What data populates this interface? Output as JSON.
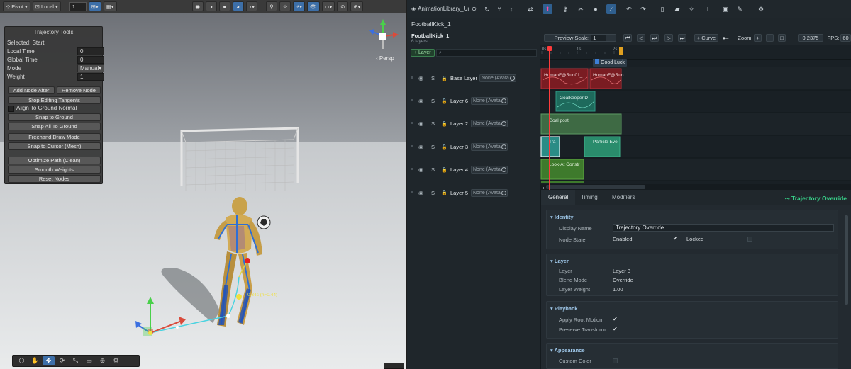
{
  "scene": {
    "toolbar": {
      "pivot": "Pivot",
      "local": "Local",
      "grid_value": "1"
    },
    "persp_label": "‹ Persp",
    "trajectory_tools": {
      "title": "Trajectory Tools",
      "selected": "Selected: Start",
      "local_time_label": "Local Time",
      "local_time_value": "0",
      "global_time_label": "Global Time",
      "global_time_value": "0",
      "mode_label": "Mode",
      "mode_value": "Manual",
      "weight_label": "Weight",
      "weight_value": "1",
      "add_node_after": "Add Node After",
      "remove_node": "Remove Node",
      "stop_editing_tangents": "Stop Editing Tangents",
      "align_to_ground_normal": "Align To Ground Normal",
      "snap_to_ground": "Snap to Ground",
      "snap_all_to_ground": "Snap All To Ground",
      "freehand_draw_mode": "Freehand Draw Mode",
      "snap_to_cursor": "Snap to Cursor (Mesh)",
      "optimize_path": "Optimize Path (Clean)",
      "smooth_weights": "Smooth Weights",
      "reset_nodes": "Reset Nodes"
    },
    "trajectory_annotation": "0.34s  (h=0.44)"
  },
  "anim": {
    "tab_title": "AnimationLibrary_Ur",
    "breadcrumb": "FootballKick_1",
    "clip_name": "FootballKick_1",
    "clip_layers": "6 layers",
    "add_layer": "+ Layer",
    "search_icon_glyph": "⌕",
    "tracks": [
      {
        "name": "Base Layer",
        "avatar": "None (Avata"
      },
      {
        "name": "Layer 6",
        "avatar": "None (Avata"
      },
      {
        "name": "Layer 2",
        "avatar": "None (Avata"
      },
      {
        "name": "Layer 3",
        "avatar": "None (Avata"
      },
      {
        "name": "Layer 4",
        "avatar": "None (Avata"
      },
      {
        "name": "Layer 5",
        "avatar": "None (Avata"
      }
    ],
    "track_s": "S",
    "timeline": {
      "preview_scale_label": "Preview Scale:",
      "preview_scale_value": "1",
      "curve_label": "+ Curve",
      "zoom_label": "Zoom:",
      "zoom_value": "0.2375",
      "fps_label": "FPS:",
      "fps_value": "60",
      "ticks": [
        "0s",
        "1s",
        "2s"
      ],
      "marker_label": "Good Luck",
      "clips": [
        {
          "label": "HumanF@Run01_",
          "track": 0
        },
        {
          "label": "HumanF@Run",
          "track": 0
        },
        {
          "label": "Goalkeeper D",
          "track": 1
        },
        {
          "label": "Goal post",
          "track": 2
        },
        {
          "label": "Tra",
          "track": 3
        },
        {
          "label": "Particle Eve",
          "track": 3
        },
        {
          "label": "Look-At Constr",
          "track": 4
        }
      ]
    },
    "inspector": {
      "tabs": [
        "General",
        "Timing",
        "Modifiers"
      ],
      "title": "Trajectory Override",
      "identity": {
        "header": "Identity",
        "display_name_label": "Display Name",
        "display_name_value": "Trajectory Override",
        "node_state_label": "Node State",
        "enabled_label": "Enabled",
        "locked_label": "Locked"
      },
      "layer": {
        "header": "Layer",
        "layer_label": "Layer",
        "layer_value": "Layer 3",
        "blend_mode_label": "Blend Mode",
        "blend_mode_value": "Override",
        "layer_weight_label": "Layer Weight",
        "layer_weight_value": "1.00"
      },
      "playback": {
        "header": "Playback",
        "apply_root_motion": "Apply Root Motion",
        "preserve_transform": "Preserve Transform"
      },
      "appearance": {
        "header": "Appearance",
        "custom_color": "Custom Color"
      }
    }
  }
}
